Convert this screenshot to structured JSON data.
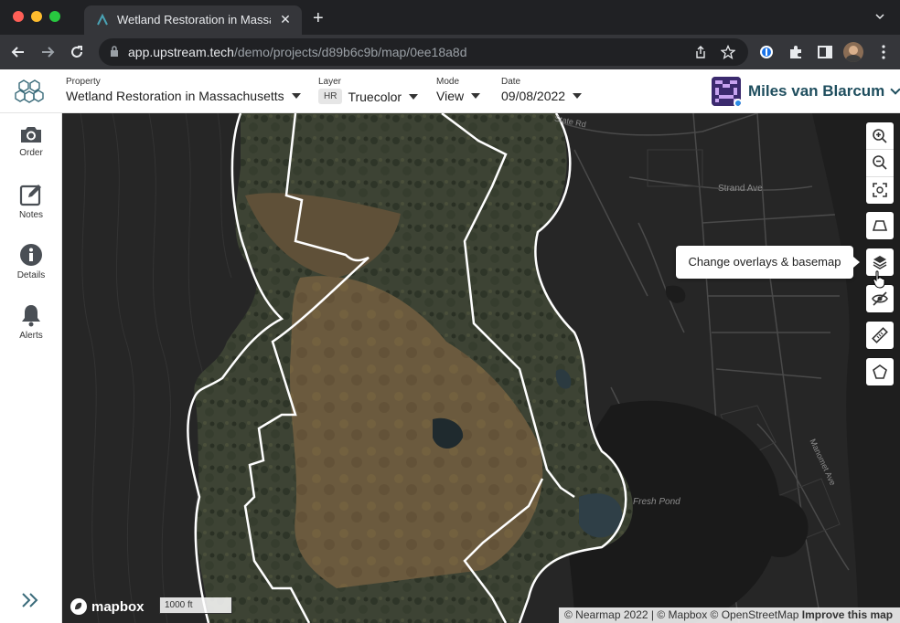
{
  "browser": {
    "tab_title": "Wetland Restoration in Massac",
    "url_host": "app.upstream.tech",
    "url_path": "/demo/projects/d89b6c9b/map/0ee18a8d",
    "traffic_colors": [
      "#ff5f57",
      "#febc2e",
      "#28c840"
    ]
  },
  "header": {
    "property_label": "Property",
    "property_value": "Wetland Restoration in Massachusetts",
    "layer_label": "Layer",
    "layer_badge": "HR",
    "layer_value": "Truecolor",
    "mode_label": "Mode",
    "mode_value": "View",
    "date_label": "Date",
    "date_value": "09/08/2022",
    "user_name": "Miles van Blarcum"
  },
  "sidebar": {
    "items": [
      {
        "label": "Order",
        "icon": "camera-icon"
      },
      {
        "label": "Notes",
        "icon": "edit-icon"
      },
      {
        "label": "Details",
        "icon": "info-icon"
      },
      {
        "label": "Alerts",
        "icon": "bell-icon"
      }
    ]
  },
  "map": {
    "road_labels": [
      "State Rd",
      "Strand Ave",
      "Manomet Ave",
      "Fresh Pond"
    ],
    "tooltip": "Change overlays & basemap",
    "scale_label": "1000 ft",
    "mapbox_label": "mapbox",
    "attribution": "© Nearmap 2022 | © Mapbox © OpenStreetMap",
    "attribution_link": "Improve this map"
  },
  "colors": {
    "accent": "#1f4e5e",
    "map_bg": "#262626",
    "aerial": "#6b5a3e"
  }
}
